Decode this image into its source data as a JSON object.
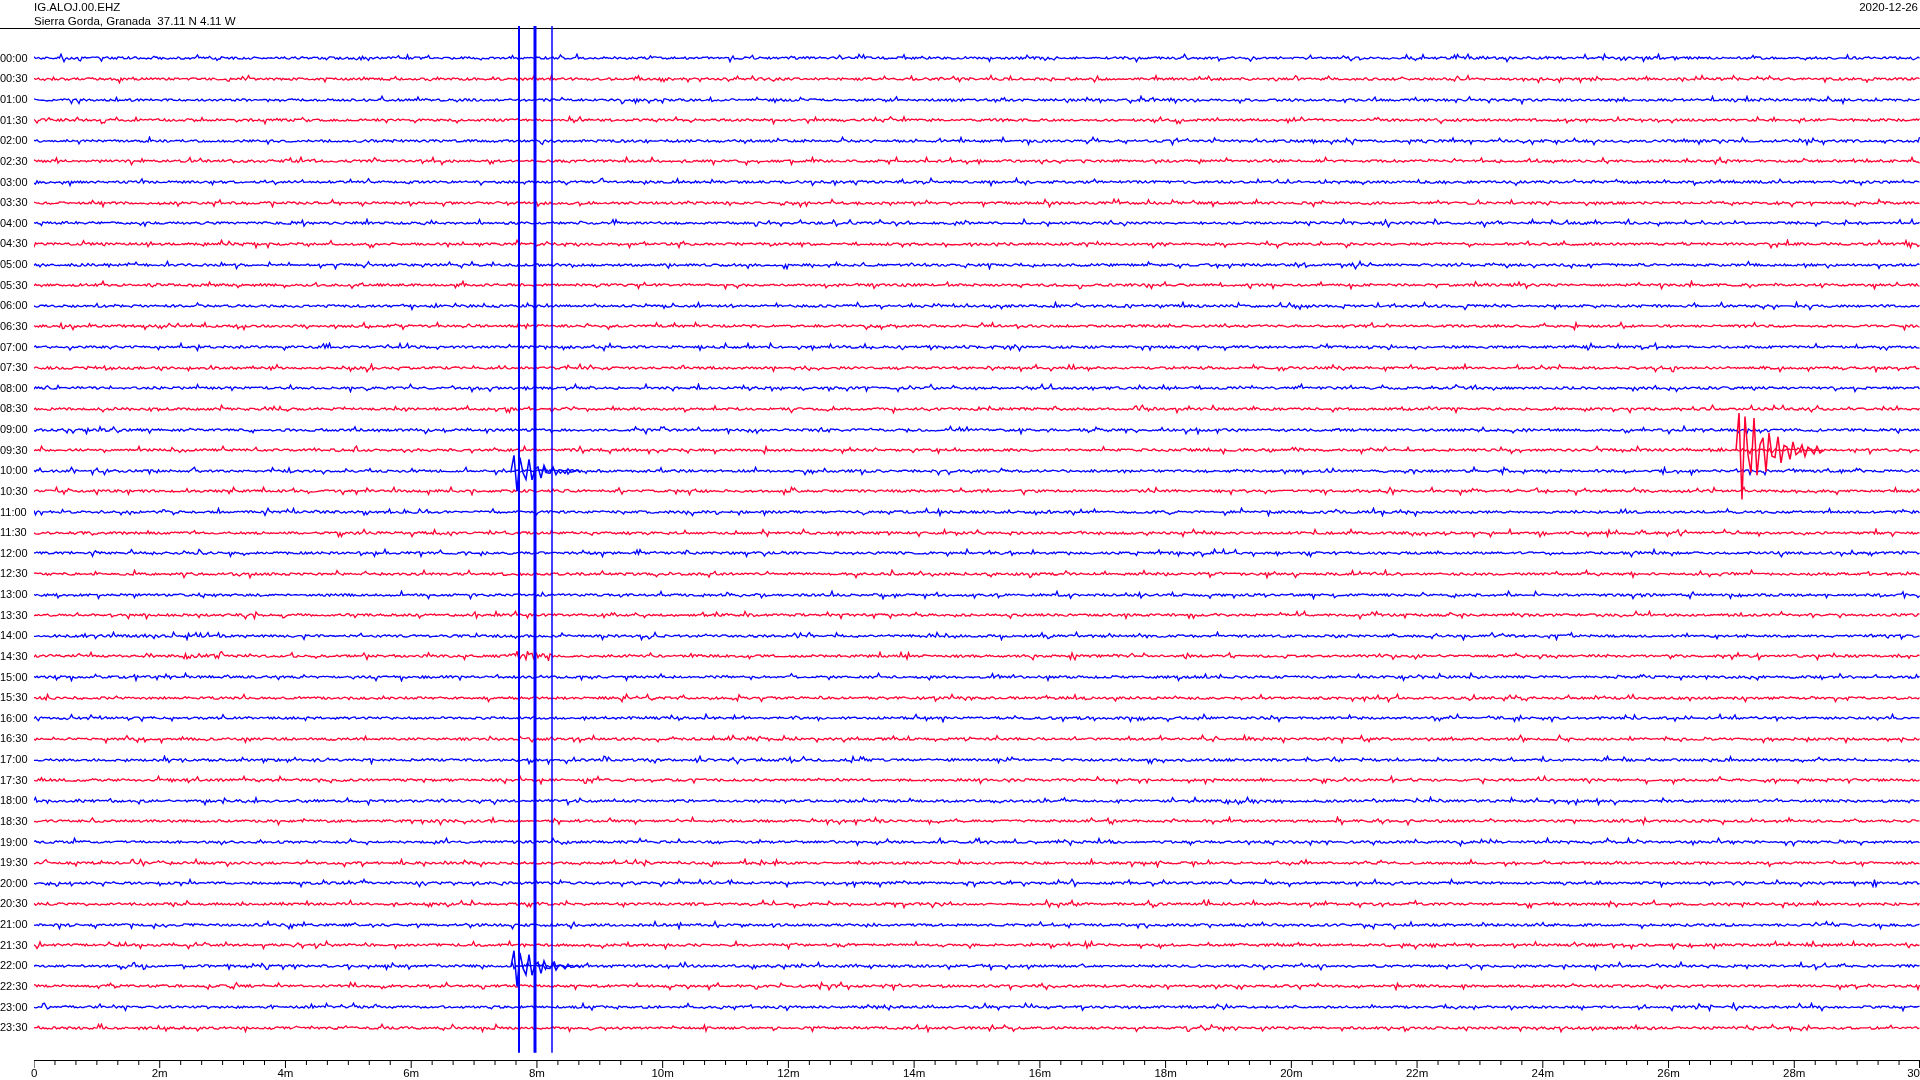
{
  "header": {
    "station": "IG.ALOJ.00.EHZ",
    "location": "Sierra Gorda, Granada  37.11 N 4.11 W",
    "date": "2020-12-26"
  },
  "rows": [
    {
      "label": "00:00",
      "color": "#0000ff"
    },
    {
      "label": "00:30",
      "color": "#ff0033"
    },
    {
      "label": "01:00",
      "color": "#0000ff"
    },
    {
      "label": "01:30",
      "color": "#ff0033"
    },
    {
      "label": "02:00",
      "color": "#0000ff"
    },
    {
      "label": "02:30",
      "color": "#ff0033"
    },
    {
      "label": "03:00",
      "color": "#0000ff"
    },
    {
      "label": "03:30",
      "color": "#ff0033"
    },
    {
      "label": "04:00",
      "color": "#0000ff"
    },
    {
      "label": "04:30",
      "color": "#ff0033"
    },
    {
      "label": "05:00",
      "color": "#0000ff"
    },
    {
      "label": "05:30",
      "color": "#ff0033"
    },
    {
      "label": "06:00",
      "color": "#0000ff"
    },
    {
      "label": "06:30",
      "color": "#ff0033"
    },
    {
      "label": "07:00",
      "color": "#0000ff"
    },
    {
      "label": "07:30",
      "color": "#ff0033"
    },
    {
      "label": "08:00",
      "color": "#0000ff"
    },
    {
      "label": "08:30",
      "color": "#ff0033"
    },
    {
      "label": "09:00",
      "color": "#0000ff"
    },
    {
      "label": "09:30",
      "color": "#ff0033"
    },
    {
      "label": "10:00",
      "color": "#0000ff"
    },
    {
      "label": "10:30",
      "color": "#ff0033"
    },
    {
      "label": "11:00",
      "color": "#0000ff"
    },
    {
      "label": "11:30",
      "color": "#ff0033"
    },
    {
      "label": "12:00",
      "color": "#0000ff"
    },
    {
      "label": "12:30",
      "color": "#ff0033"
    },
    {
      "label": "13:00",
      "color": "#0000ff"
    },
    {
      "label": "13:30",
      "color": "#ff0033"
    },
    {
      "label": "14:00",
      "color": "#0000ff"
    },
    {
      "label": "14:30",
      "color": "#ff0033"
    },
    {
      "label": "15:00",
      "color": "#0000ff"
    },
    {
      "label": "15:30",
      "color": "#ff0033"
    },
    {
      "label": "16:00",
      "color": "#0000ff"
    },
    {
      "label": "16:30",
      "color": "#ff0033"
    },
    {
      "label": "17:00",
      "color": "#0000ff"
    },
    {
      "label": "17:30",
      "color": "#ff0033"
    },
    {
      "label": "18:00",
      "color": "#0000ff"
    },
    {
      "label": "18:30",
      "color": "#ff0033"
    },
    {
      "label": "19:00",
      "color": "#0000ff"
    },
    {
      "label": "19:30",
      "color": "#ff0033"
    },
    {
      "label": "20:00",
      "color": "#0000ff"
    },
    {
      "label": "20:30",
      "color": "#ff0033"
    },
    {
      "label": "21:00",
      "color": "#0000ff"
    },
    {
      "label": "21:30",
      "color": "#ff0033"
    },
    {
      "label": "22:00",
      "color": "#0000ff"
    },
    {
      "label": "22:30",
      "color": "#ff0033"
    },
    {
      "label": "23:00",
      "color": "#0000ff"
    },
    {
      "label": "23:30",
      "color": "#ff0033"
    }
  ],
  "x_axis": {
    "ticks": [
      "0",
      "2m",
      "4m",
      "6m",
      "8m",
      "10m",
      "12m",
      "14m",
      "16m",
      "18m",
      "20m",
      "22m",
      "24m",
      "26m",
      "28m",
      "30"
    ]
  }
}
